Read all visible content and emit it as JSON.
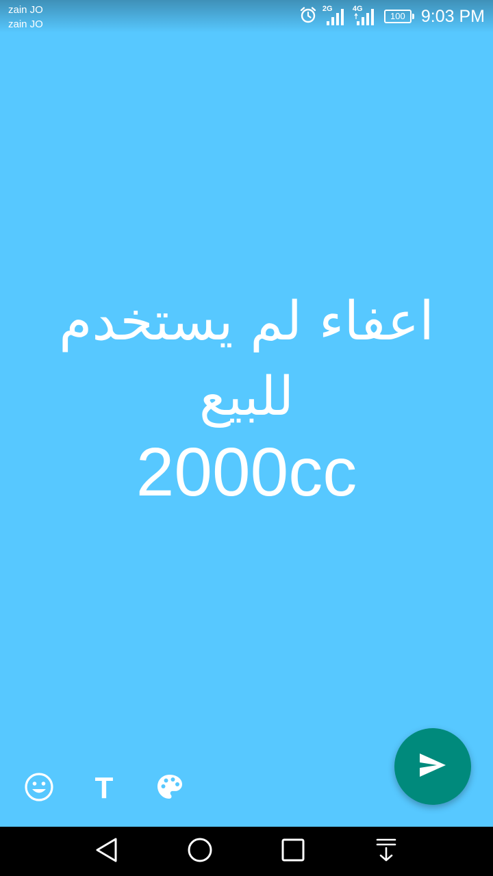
{
  "status_bar": {
    "carriers": [
      "zain JO",
      "zain JO"
    ],
    "network_1": "2G",
    "network_2": "4G",
    "battery_level": "100",
    "time": "9:03 PM",
    "icons": [
      "alarm-icon",
      "signal-icon",
      "signal-icon",
      "battery-icon"
    ]
  },
  "status_post": {
    "lines": [
      "اعفاء لم يستخدم",
      "للبيع",
      "2000cc"
    ],
    "background_color": "#57c8ff",
    "text_color": "#ffffff"
  },
  "toolbar": {
    "emoji_icon": "emoji-icon",
    "text_tool_label": "T",
    "palette_icon": "palette-icon"
  },
  "send_button": {
    "icon": "send-icon",
    "color": "#008a7c"
  },
  "nav_bar": {
    "icons": [
      "back-icon",
      "home-icon",
      "recents-icon",
      "notification-pull-icon"
    ]
  }
}
